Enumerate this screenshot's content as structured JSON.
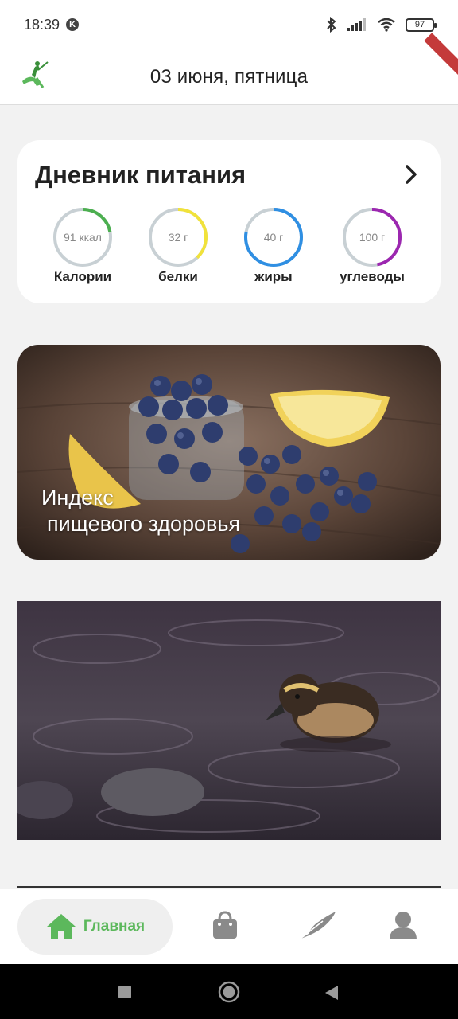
{
  "status_bar": {
    "time": "18:39",
    "battery": "97"
  },
  "app_bar": {
    "title": "03 июня, пятница",
    "logo_icon": "runner-logo-icon"
  },
  "diary": {
    "title": "Дневник питания",
    "macros": [
      {
        "label": "Калории",
        "value": "91 ккал",
        "progress": 0.22,
        "color": "#4caf50"
      },
      {
        "label": "белки",
        "value": "32 г",
        "progress": 0.38,
        "color": "#f1e23a"
      },
      {
        "label": "жиры",
        "value": "40 г",
        "progress": 0.78,
        "color": "#2f8fe3"
      },
      {
        "label": "углеводы",
        "value": "100 г",
        "progress": 0.47,
        "color": "#9c27b0"
      }
    ]
  },
  "health_card": {
    "caption_line1": "Индекс",
    "caption_line2": "пищевого здоровья"
  },
  "bottom_nav": {
    "home_label": "Главная",
    "items": [
      "home-icon",
      "shopping-bag-icon",
      "feather-icon",
      "profile-icon"
    ],
    "active_color": "#5cb85c",
    "inactive_color": "#8a8a8a"
  }
}
